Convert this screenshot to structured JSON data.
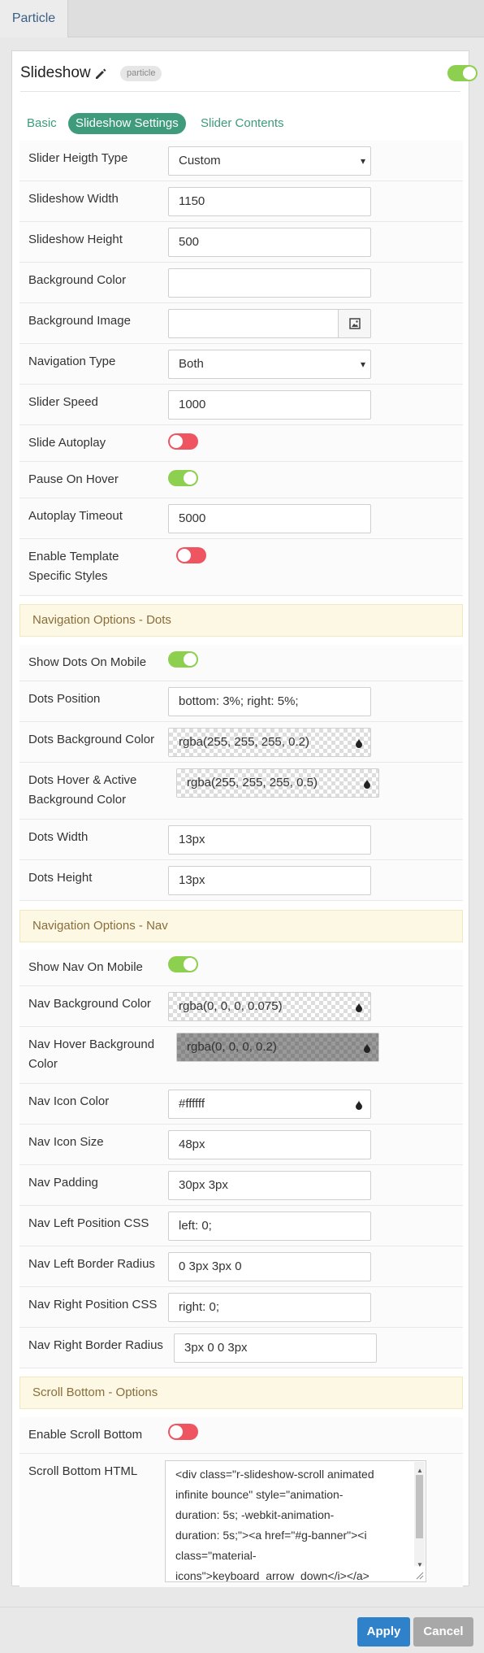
{
  "top_tab": {
    "label": "Particle"
  },
  "header": {
    "title": "Slideshow",
    "badge": "particle",
    "enabled": true
  },
  "subtabs": [
    "Basic",
    "Slideshow Settings",
    "Slider Contents"
  ],
  "fields": {
    "slider_height_type": {
      "label": "Slider Heigth Type",
      "value": "Custom"
    },
    "slideshow_width": {
      "label": "Slideshow Width",
      "value": "1150"
    },
    "slideshow_height": {
      "label": "Slideshow Height",
      "value": "500"
    },
    "background_color": {
      "label": "Background Color",
      "value": ""
    },
    "background_image": {
      "label": "Background Image",
      "value": "",
      "icon": "image-icon"
    },
    "navigation_type": {
      "label": "Navigation Type",
      "value": "Both"
    },
    "slider_speed": {
      "label": "Slider Speed",
      "value": "1000"
    },
    "slide_autoplay": {
      "label": "Slide Autoplay",
      "on": false
    },
    "pause_on_hover": {
      "label": "Pause On Hover",
      "on": true
    },
    "autoplay_timeout": {
      "label": "Autoplay Timeout",
      "value": "5000"
    },
    "enable_template_styles": {
      "label_1": "Enable Template",
      "label_2": "Specific Styles",
      "on": false
    }
  },
  "section_dots": {
    "title": "Navigation Options - Dots"
  },
  "dots": {
    "show_on_mobile": {
      "label": "Show Dots On Mobile",
      "on": true
    },
    "position": {
      "label": "Dots Position",
      "value": "bottom: 3%; right: 5%;"
    },
    "bg_color": {
      "label": "Dots Background Color",
      "value": "rgba(255, 255, 255, 0.2)"
    },
    "hover_bg": {
      "label_1": "Dots Hover & Active",
      "label_2": "Background Color",
      "value": "rgba(255, 255, 255, 0.5)"
    },
    "width": {
      "label": "Dots Width",
      "value": "13px"
    },
    "height": {
      "label": "Dots Height",
      "value": "13px"
    }
  },
  "section_nav": {
    "title": "Navigation Options - Nav"
  },
  "nav": {
    "show_on_mobile": {
      "label": "Show Nav On Mobile",
      "on": true
    },
    "bg_color": {
      "label": "Nav Background Color",
      "value": "rgba(0, 0, 0, 0.075)"
    },
    "hover_bg": {
      "label_1": "Nav Hover Background",
      "label_2": "Color",
      "value": "rgba(0, 0, 0, 0.2)"
    },
    "icon_color": {
      "label": "Nav Icon Color",
      "value": "#ffffff"
    },
    "icon_size": {
      "label": "Nav Icon Size",
      "value": "48px"
    },
    "padding": {
      "label": "Nav Padding",
      "value": "30px 3px"
    },
    "left_css": {
      "label": "Nav Left Position CSS",
      "value": "left: 0;"
    },
    "left_radius": {
      "label": "Nav Left Border Radius",
      "value": "0 3px 3px 0"
    },
    "right_css": {
      "label": "Nav Right Position CSS",
      "value": "right: 0;"
    },
    "right_radius": {
      "label": "Nav Right Border Radius",
      "value": "3px 0 0 3px"
    }
  },
  "section_scroll": {
    "title": "Scroll Bottom - Options"
  },
  "scroll": {
    "enable": {
      "label": "Enable Scroll Bottom",
      "on": false
    },
    "html": {
      "label": "Scroll Bottom HTML",
      "lines": [
        "<div class=\"r-slideshow-scroll animated",
        "infinite bounce\" style=\"animation-",
        "duration: 5s; -webkit-animation-",
        "duration: 5s;\"><a href=\"#g-banner\"><i",
        "class=\"material-",
        "icons\">keyboard_arrow_down</i></a>"
      ]
    }
  },
  "footer": {
    "apply": "Apply",
    "cancel": "Cancel"
  },
  "colors": {
    "accent": "#3e9b7b",
    "toggle_on": "#8dcf4e",
    "toggle_off": "#ef5461",
    "apply": "#2f82c9"
  }
}
